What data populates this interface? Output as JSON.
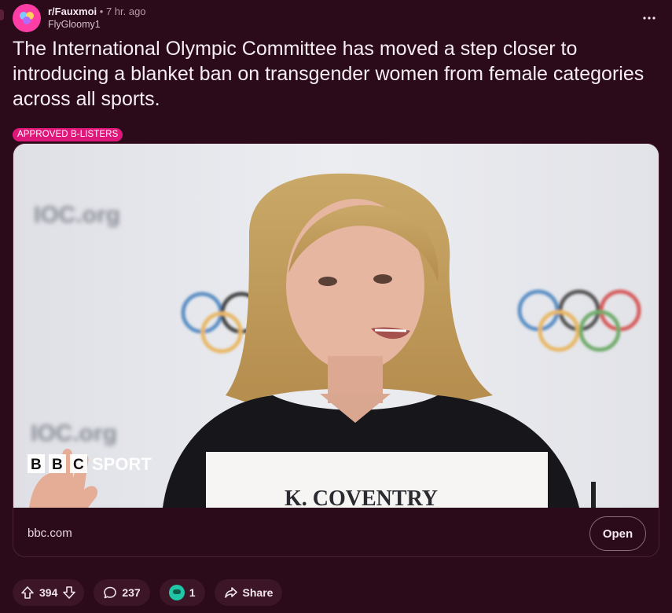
{
  "post": {
    "subreddit": "r/Fauxmoi",
    "separator": "•",
    "time": "7 hr. ago",
    "username": "FlyGloomy1",
    "title": "The International Olympic Committee has moved a step closer to introducing a blanket ban on transgender women from female categories across all sports.",
    "flair": "APPROVED B-LISTERS",
    "more_icon": "more-horizontal-icon"
  },
  "link_card": {
    "image_alt": "Kirsty Coventry speaking at press conference",
    "image_watermark": "BBC SPORT",
    "bbc_letters": [
      "B",
      "B",
      "C"
    ],
    "sport_word": "SPORT",
    "background_text": "IOC.org",
    "nameplate_text": "K. COVENTRY",
    "domain": "bbc.com",
    "open_label": "Open"
  },
  "actions": {
    "upvotes": "394",
    "comments": "237",
    "awards": "1",
    "share_label": "Share"
  },
  "colors": {
    "background": "#2b0a19",
    "accent": "#e0177a",
    "avatar": "#ff3ea5",
    "pill": "#3c1526"
  }
}
